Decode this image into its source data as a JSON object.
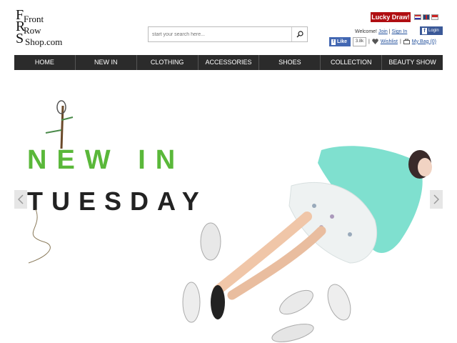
{
  "logo": {
    "line1": "Front",
    "line2": "Row",
    "line3": "Shop.com"
  },
  "search": {
    "placeholder": "start your search here..."
  },
  "header": {
    "lucky_draw": "Lucky Draw!",
    "welcome": "Welcome!",
    "join": "Join",
    "separator": "|",
    "sign_in": "Sign In",
    "fb_login": "Login",
    "like": "Like",
    "like_count": "3.8k",
    "wishlist": "Wishlist",
    "my_bag": "My Bag (0)"
  },
  "nav": {
    "items": [
      {
        "label": "HOME"
      },
      {
        "label": "NEW IN"
      },
      {
        "label": "CLOTHING"
      },
      {
        "label": "ACCESSORIES"
      },
      {
        "label": "SHOES"
      },
      {
        "label": "COLLECTION"
      },
      {
        "label": "BEAUTY SHOW"
      }
    ]
  },
  "banner": {
    "line1": "NEW IN",
    "line2": "TUESDAY"
  },
  "colors": {
    "lucky_red": "#b00e12",
    "nav_bg": "#2b2b2b",
    "facebook_blue": "#3b5998",
    "link_blue": "#1f4e9b"
  },
  "icons": [
    "search-icon",
    "heart-icon",
    "bag-icon",
    "facebook-icon",
    "chevron-left-icon",
    "chevron-right-icon"
  ]
}
